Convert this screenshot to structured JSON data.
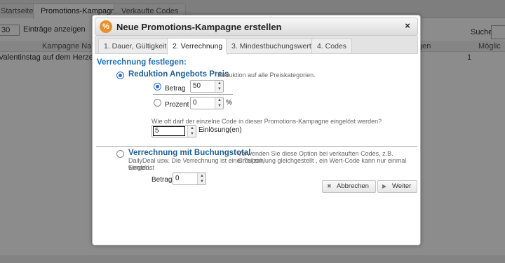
{
  "background": {
    "tabs": [
      "Startseite",
      "Promotions-Kampagne",
      "Verkaufte Codes"
    ],
    "entries_select_value": "30",
    "entries_label": "Einträge anzeigen",
    "search_label": "Suchen",
    "columns": [
      "Kampagne Name",
      "gen",
      "Möglic"
    ],
    "row": {
      "name": "Valentinstag auf dem Herzerlweg",
      "count": "1"
    }
  },
  "dialog": {
    "title": "Neue Promotions-Kampagne erstellen",
    "close_symbol": "×",
    "tabs": [
      "1. Dauer, Gültigkeit",
      "2. Verrechnung",
      "3. Mindestbuchungswert",
      "4. Codes"
    ],
    "active_tab": 1,
    "section_title": "Verrechnung festlegen:",
    "option1": {
      "title": "Reduktion Angebots Preis",
      "description": "Reduktion auf alle Preiskategorien.",
      "betrag_label": "Betrag",
      "betrag_value": "50",
      "prozent_label": "Prozent",
      "prozent_value": "0",
      "percent_sign": "%",
      "question": "Wie oft darf der einzelne Code in dieser Promotions-Kampagne eingelöst werden?",
      "redemptions_value": "5",
      "redemptions_unit": "Einlösung(en)"
    },
    "option2": {
      "title": "Verrechnung mit Buchungstotal",
      "description_line1": "Verwenden Sie diese Option bei verkauften Codes, z.B. Groupon,",
      "description_line2": "DailyDeal usw. Die Verrechnung ist einer Teilzahlung gleichgestellt , ein Wert-Code kann nur einmal Eingelöst",
      "description_line3": "werden.",
      "betrag_label": "Betrag",
      "betrag_value": "0"
    },
    "buttons": {
      "cancel": "Abbrechen",
      "next": "Weiter"
    }
  }
}
